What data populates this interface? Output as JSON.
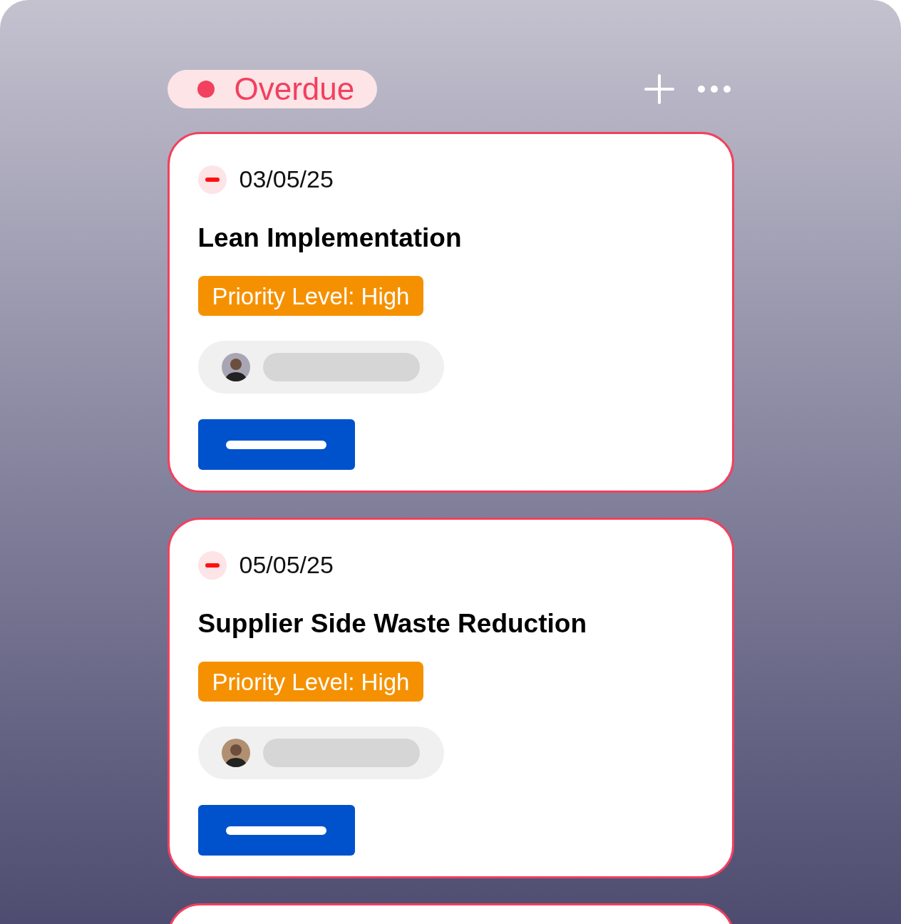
{
  "column": {
    "title": "Overdue",
    "color": "#f2405f"
  },
  "cards": [
    {
      "date": "03/05/25",
      "title": "Lean Implementation",
      "priority": "Priority Level: High"
    },
    {
      "date": "05/05/25",
      "title": "Supplier Side Waste Reduction",
      "priority": "Priority Level: High"
    }
  ],
  "more_cards_below": true
}
